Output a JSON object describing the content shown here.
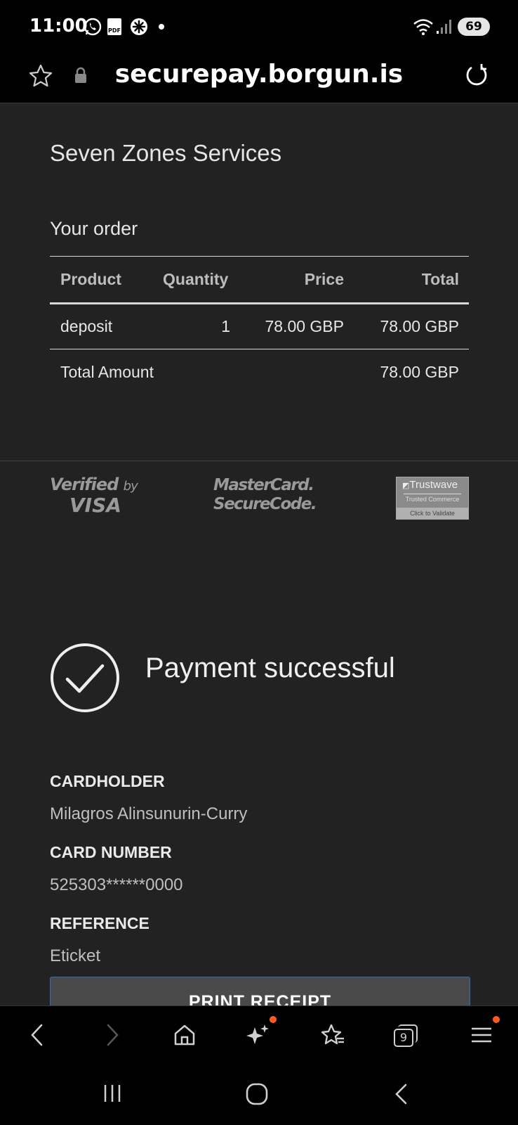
{
  "status_bar": {
    "time": "11:00",
    "battery": "69",
    "icons": [
      "whatsapp-icon",
      "pdf-icon",
      "flower-icon",
      "notification-dot",
      "wifi-icon",
      "signal-icon"
    ]
  },
  "url_bar": {
    "url": "securepay.borgun.is",
    "icons": [
      "star-icon",
      "lock-icon",
      "refresh-icon"
    ]
  },
  "merchant": "Seven Zones Services",
  "order": {
    "title": "Your order",
    "headers": {
      "product": "Product",
      "quantity": "Quantity",
      "price": "Price",
      "total": "Total"
    },
    "rows": [
      {
        "product": "deposit",
        "quantity": "1",
        "price": "78.00 GBP",
        "total": "78.00 GBP"
      }
    ],
    "total_label": "Total Amount",
    "total_value": "78.00 GBP"
  },
  "security_logos": {
    "visa_line1": "Verified",
    "visa_by": "by",
    "visa_line2": "VISA",
    "mc_line1": "MasterCard.",
    "mc_line2": "SecureCode.",
    "trustwave_name": "Trustwave",
    "trustwave_sub": "Trusted Commerce",
    "trustwave_cta": "Click to Validate"
  },
  "result": {
    "message": "Payment successful",
    "icon": "check-circle-icon"
  },
  "details": {
    "cardholder_label": "CARDHOLDER",
    "cardholder_value": "Milagros Alinsunurin-Curry",
    "card_number_label": "CARD NUMBER",
    "card_number_value": "525303******0000",
    "reference_label": "REFERENCE",
    "reference_value": "Eticket"
  },
  "print_button": "PRINT RECEIPT",
  "browser_toolbar": {
    "tabs_count": "9",
    "accent": "#ff5a1f"
  }
}
